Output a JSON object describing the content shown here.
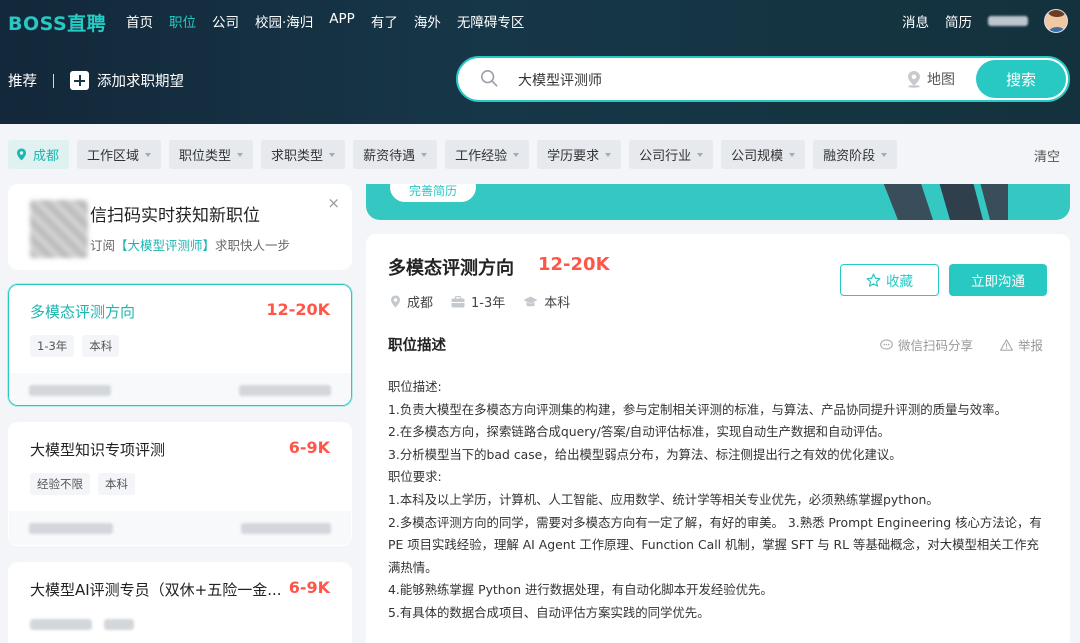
{
  "header": {
    "logo": "BOSS直聘",
    "nav": [
      "首页",
      "职位",
      "公司",
      "校园·海归",
      "APP",
      "有了",
      "海外",
      "无障碍专区"
    ],
    "active_nav": 1,
    "messages": "消息",
    "resume": "简历",
    "recommend": "推荐",
    "add_expectation": "添加求职期望",
    "search_value": "大模型评测师",
    "map_label": "地图",
    "search_button": "搜索"
  },
  "filters": {
    "city": "成都",
    "items": [
      "工作区域",
      "职位类型",
      "求职类型",
      "薪资待遇",
      "工作经验",
      "学历要求",
      "公司行业",
      "公司规模",
      "融资阶段"
    ],
    "clear": "清空"
  },
  "subscribe": {
    "title": "信扫码实时获知新职位",
    "desc_prefix": "订阅",
    "desc_highlight": "【大模型评测师】",
    "desc_suffix": "求职快人一步",
    "close": "×"
  },
  "job_list": [
    {
      "title": "多模态评测方向",
      "salary": "12-20K",
      "tags": [
        "1-3年",
        "本科"
      ]
    },
    {
      "title": "大模型知识专项评测",
      "salary": "6-9K",
      "tags": [
        "经验不限",
        "本科"
      ]
    },
    {
      "title": "大模型AI评测专员（双休+五险一金...",
      "salary": "6-9K",
      "tags": []
    }
  ],
  "banner": {
    "button": "完善简历"
  },
  "detail": {
    "title": "多模态评测方向",
    "salary": "12-20K",
    "city": "成都",
    "experience": "1-3年",
    "education": "本科",
    "favorite": "收藏",
    "chat": "立即沟通",
    "section_title": "职位描述",
    "share": "微信扫码分享",
    "report": "举报",
    "lines": [
      "职位描述:",
      "1.负责大模型在多模态方向评测集的构建，参与定制相关评测的标准，与算法、产品协同提升评测的质量与效率。",
      "2.在多模态方向，探索链路合成query/答案/自动评估标准，实现自动生产数据和自动评估。",
      "3.分析模型当下的bad case，给出模型弱点分布，为算法、标注侧提出行之有效的优化建议。",
      "职位要求:",
      "1.本科及以上学历，计算机、人工智能、应用数学、统计学等相关专业优先，必须熟练掌握python。",
      "2.多模态评测方向的同学，需要对多模态方向有一定了解，有好的审美。 3.熟悉 Prompt Engineering 核心方法论，有 PE 项目实践经验，理解 AI Agent 工作原理、Function Call 机制，掌握 SFT 与 RL 等基础概念，对大模型相关工作充满热情。",
      "4.能够熟练掌握 Python 进行数据处理，有自动化脚本开发经验优先。",
      "5.有具体的数据合成项目、自动评估方案实践的同学优先。"
    ]
  },
  "colors": {
    "accent": "#28c8c3",
    "salary": "#fe574a",
    "header_bg": "#163748"
  }
}
